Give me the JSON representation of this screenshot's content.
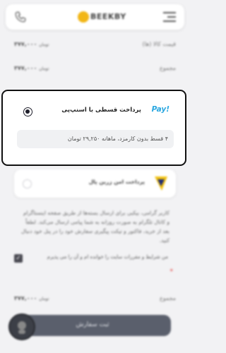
{
  "header": {
    "logo_text": "BEEKBY"
  },
  "summary": {
    "price_label": "قیمت کالا (ها)",
    "price_value": "۳۷۷,۰۰۰",
    "price_currency": "تومان",
    "total_label": "مجموع",
    "total_value": "۳۷۷,۰۰۰",
    "total_currency": "تومان"
  },
  "snappay": {
    "logo": "Pay!",
    "title": "پرداخت قسطی با اسنپ‌پی",
    "subtitle": "۴ قسط بدون کارمزد، ماهانه ۲۹,۲۵۰ تومان"
  },
  "zarinpal": {
    "title": "پرداخت امن زرین پال"
  },
  "policy_text": "کاربر گرامی، بیکبی برای ارسال بسته‌ها از طریق صفحه اینستاگرام و کانال تلگرام به صورت روزانه به شما پیامی ارسال می‌کند. لطفاً بعد از خرید، فاکتور و تیکت پیگیری سفارش خود را در پنل خود دنبال کنید.",
  "consent": {
    "label": "من شرایط و مقررات سایت را خوانده ام و آن را می پذیرم",
    "required_mark": "*"
  },
  "footer_total": {
    "label": "مجموع",
    "value": "۳۷۷,۰۰۰",
    "currency": "تومان"
  },
  "submit_label": "ثبت سفارش"
}
